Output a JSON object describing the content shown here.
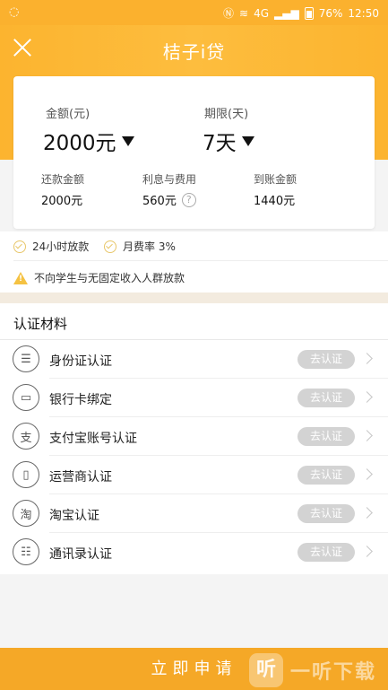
{
  "status_bar": {
    "time": "12:50",
    "battery": "76%",
    "network": "4G"
  },
  "header": {
    "title": "桔子i贷",
    "close_icon": "close-icon"
  },
  "loan": {
    "amount_label": "金额(元)",
    "amount_value": "2000元",
    "term_label": "期限(天)",
    "term_value": "7天",
    "repay_label": "还款金额",
    "repay_value": "2000元",
    "interest_label": "利息与费用",
    "interest_value": "560元",
    "help_mark": "?",
    "received_label": "到账金额",
    "received_value": "1440元"
  },
  "features": {
    "item1": "24小时放款",
    "item2": "月费率 3%",
    "warning": "不向学生与无固定收入人群放款",
    "warn_mark": "!"
  },
  "materials": {
    "title": "认证材料",
    "rows": [
      {
        "label": "身份证认证",
        "button": "去认证",
        "icon": "id-card-icon",
        "glyph": "☰"
      },
      {
        "label": "银行卡绑定",
        "button": "去认证",
        "icon": "bank-card-icon",
        "glyph": "▭"
      },
      {
        "label": "支付宝账号认证",
        "button": "去认证",
        "icon": "alipay-icon",
        "glyph": "支"
      },
      {
        "label": "运营商认证",
        "button": "去认证",
        "icon": "mobile-carrier-icon",
        "glyph": "▯"
      },
      {
        "label": "淘宝认证",
        "button": "去认证",
        "icon": "taobao-icon",
        "glyph": "淘"
      },
      {
        "label": "通讯录认证",
        "button": "去认证",
        "icon": "contacts-icon",
        "glyph": "☷"
      }
    ]
  },
  "footer": {
    "apply_label": "立即申请"
  },
  "watermark": {
    "icon_text": "听",
    "text": "一听下载"
  },
  "colors": {
    "brand": "#fcb42f",
    "button_bg": "#f5a827",
    "badge_gray": "#d3d3d3"
  }
}
